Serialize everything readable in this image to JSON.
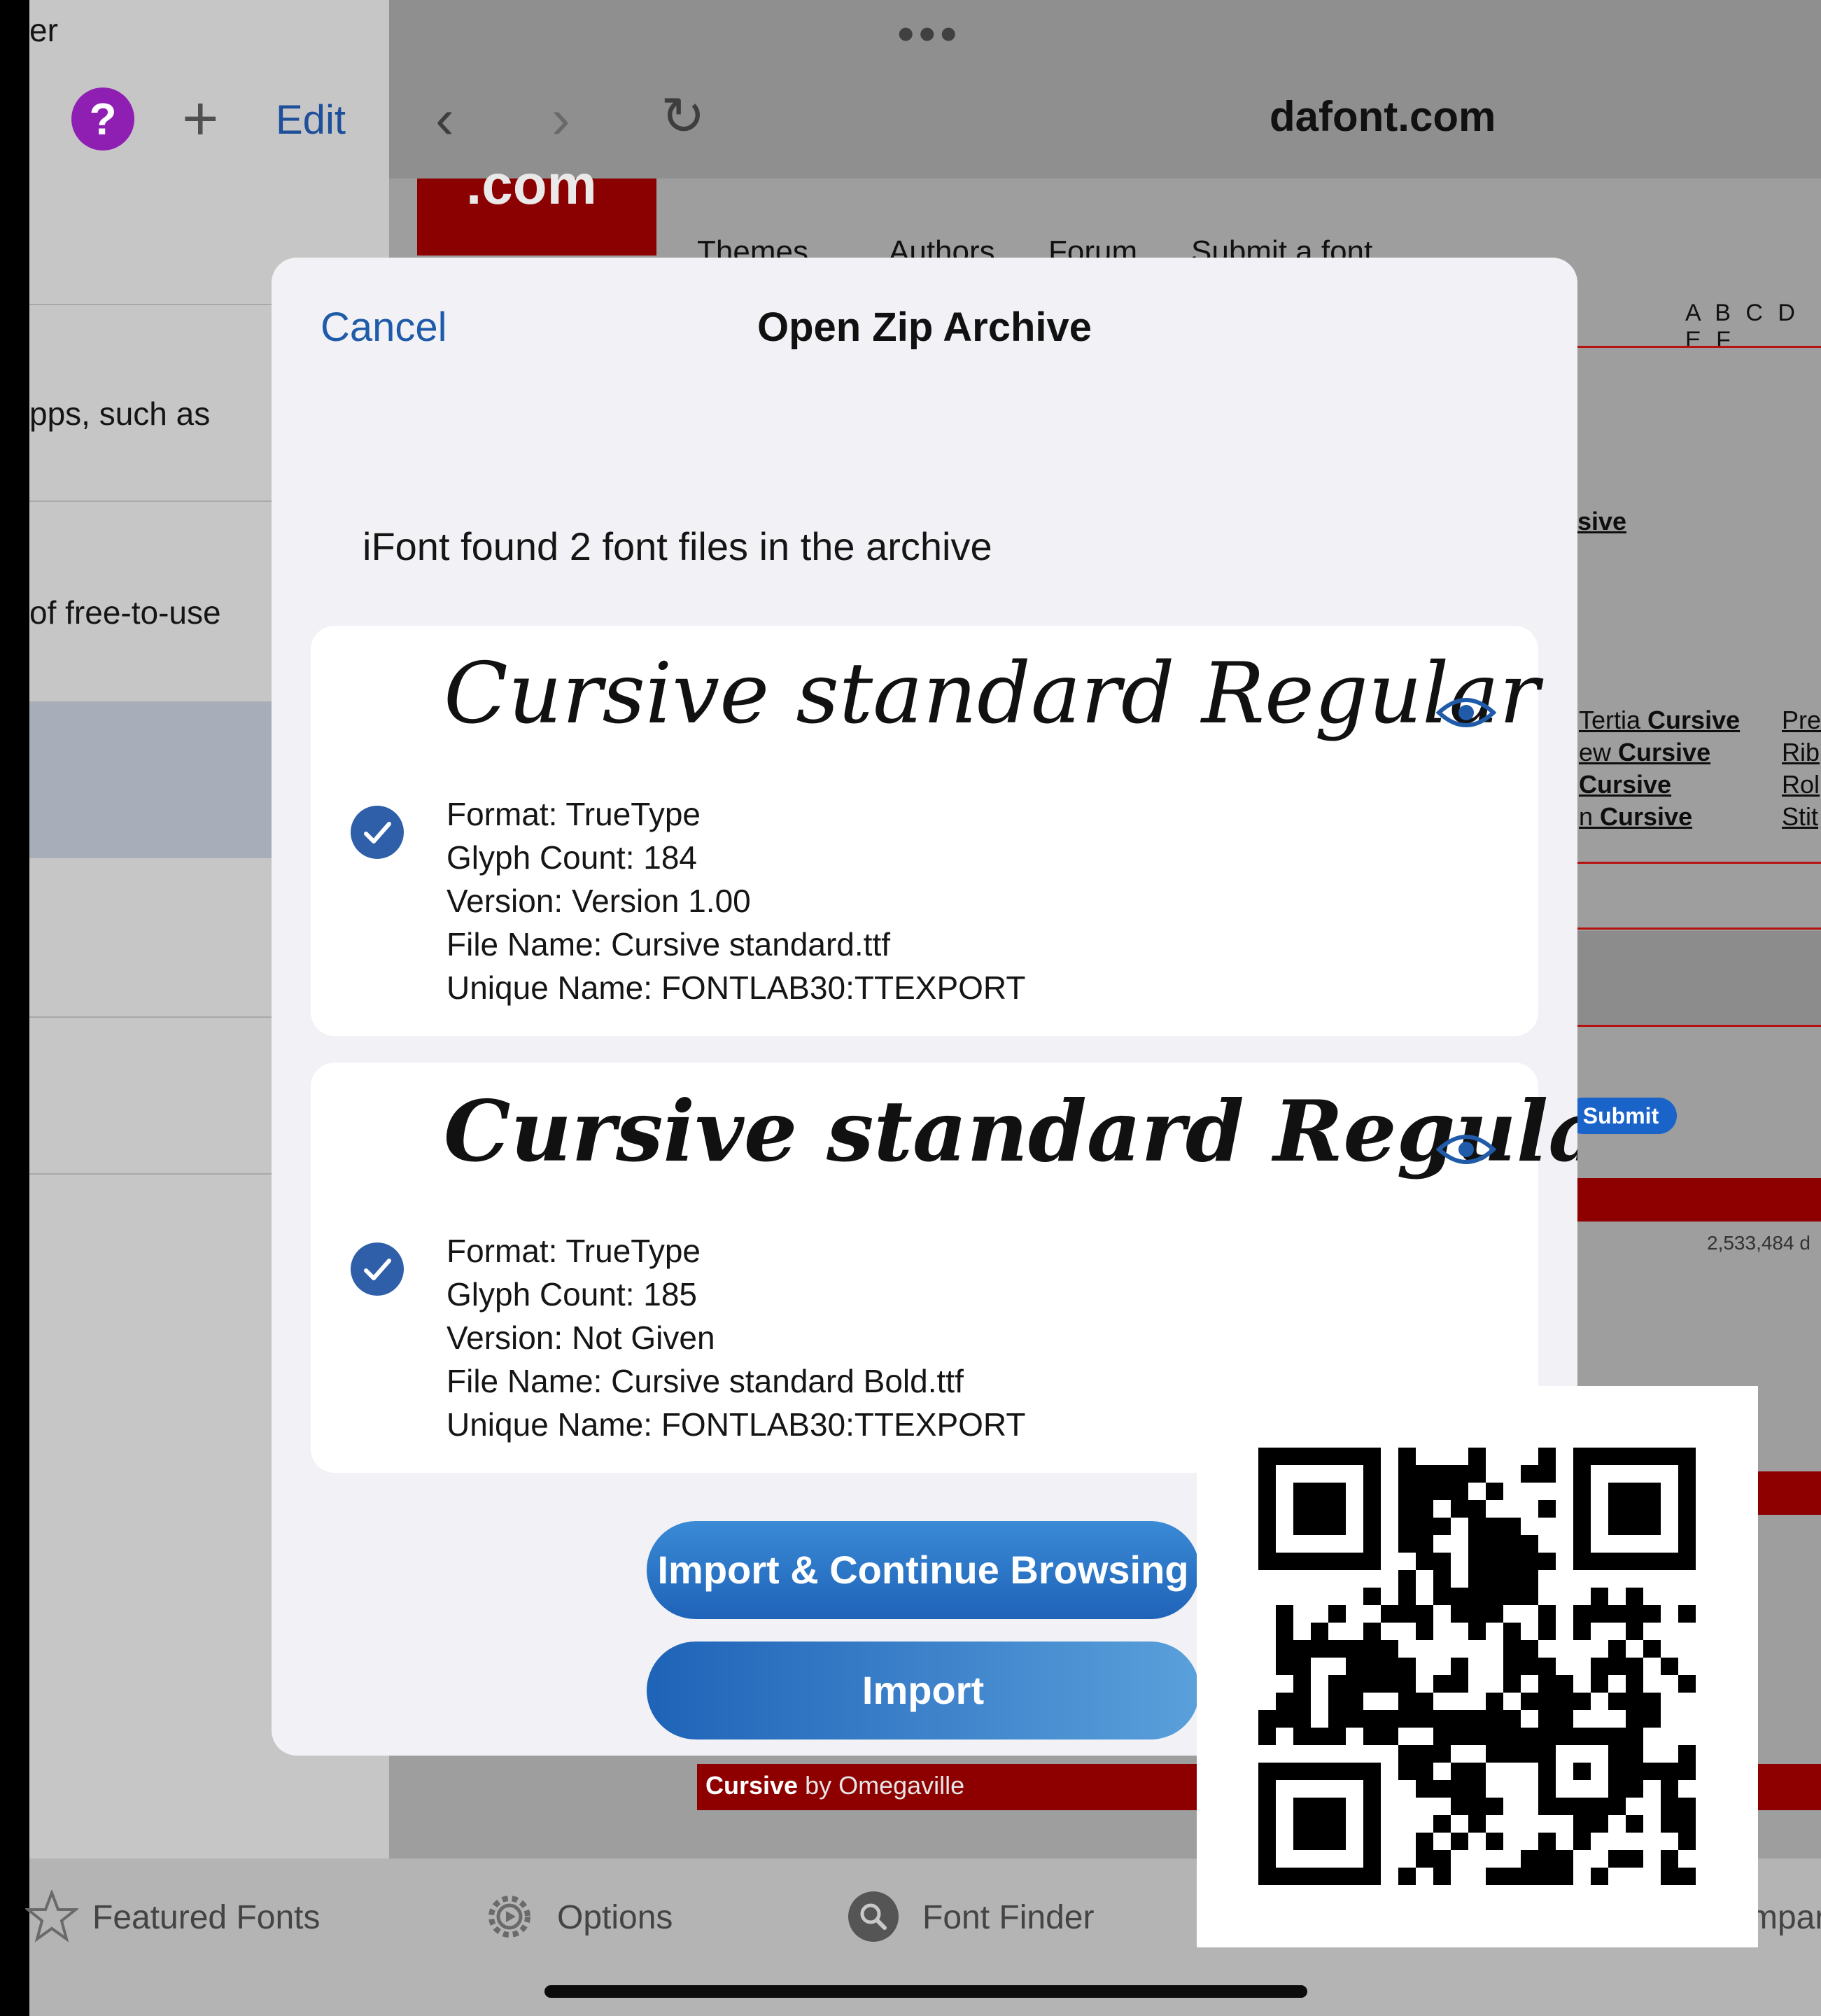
{
  "sidebar": {
    "partial_title": "er",
    "edit_label": "Edit",
    "help_icon": "?",
    "text_1": "pps, such as",
    "text_2": "of free-to-use"
  },
  "browser": {
    "url": "dafont.com",
    "logo_text": ".com",
    "nav": [
      "Themes",
      "Authors",
      "Forum",
      "Submit a font"
    ],
    "alphabet": "A B C D E F",
    "link_sive": "sive",
    "links_col1": [
      {
        "pre": "Tertia ",
        "bold": "Cursive"
      },
      {
        "pre": "ew ",
        "bold": "Cursive"
      },
      {
        "pre": "",
        "bold": "Cursive"
      },
      {
        "pre": "n ",
        "bold": "Cursive"
      }
    ],
    "links_col2": [
      "Pre",
      "Rib",
      "Rol",
      "Stit"
    ],
    "submit_label": "Submit",
    "download_count": "2,533,484 d",
    "font_bar_name": "Cursive",
    "font_bar_author": " by Omegaville"
  },
  "modal": {
    "cancel_label": "Cancel",
    "title": "Open Zip Archive",
    "found_text": "iFont found 2 font files in the archive",
    "fonts": [
      {
        "preview": "Cursive standard Regular",
        "format": "Format: TrueType",
        "glyphs": "Glyph Count: 184",
        "version": "Version: Version 1.00",
        "file": "File Name: Cursive standard.ttf",
        "unique": "Unique Name: FONTLAB30:TTEXPORT",
        "checked": true
      },
      {
        "preview": "Cursive standard Regular",
        "format": "Format: TrueType",
        "glyphs": "Glyph Count: 185",
        "version": "Version: Not Given",
        "file": "File Name: Cursive standard Bold.ttf",
        "unique": "Unique Name: FONTLAB30:TTEXPORT",
        "checked": true
      }
    ],
    "import_continue_label": "Import & Continue Browsing",
    "import_label": "Import"
  },
  "tabbar": {
    "featured": "Featured Fonts",
    "options": "Options",
    "finder": "Font Finder",
    "compare_partial": "mpare"
  },
  "colors": {
    "accent_blue": "#1f5ba8",
    "help_purple": "#8f1fb3",
    "dafont_red": "#8e0000"
  },
  "icons": [
    "help-icon",
    "plus-icon",
    "back-icon",
    "forward-icon",
    "reload-icon",
    "eye-icon",
    "checkmark-icon",
    "star-icon",
    "gear-icon",
    "search-icon",
    "qr-code"
  ]
}
